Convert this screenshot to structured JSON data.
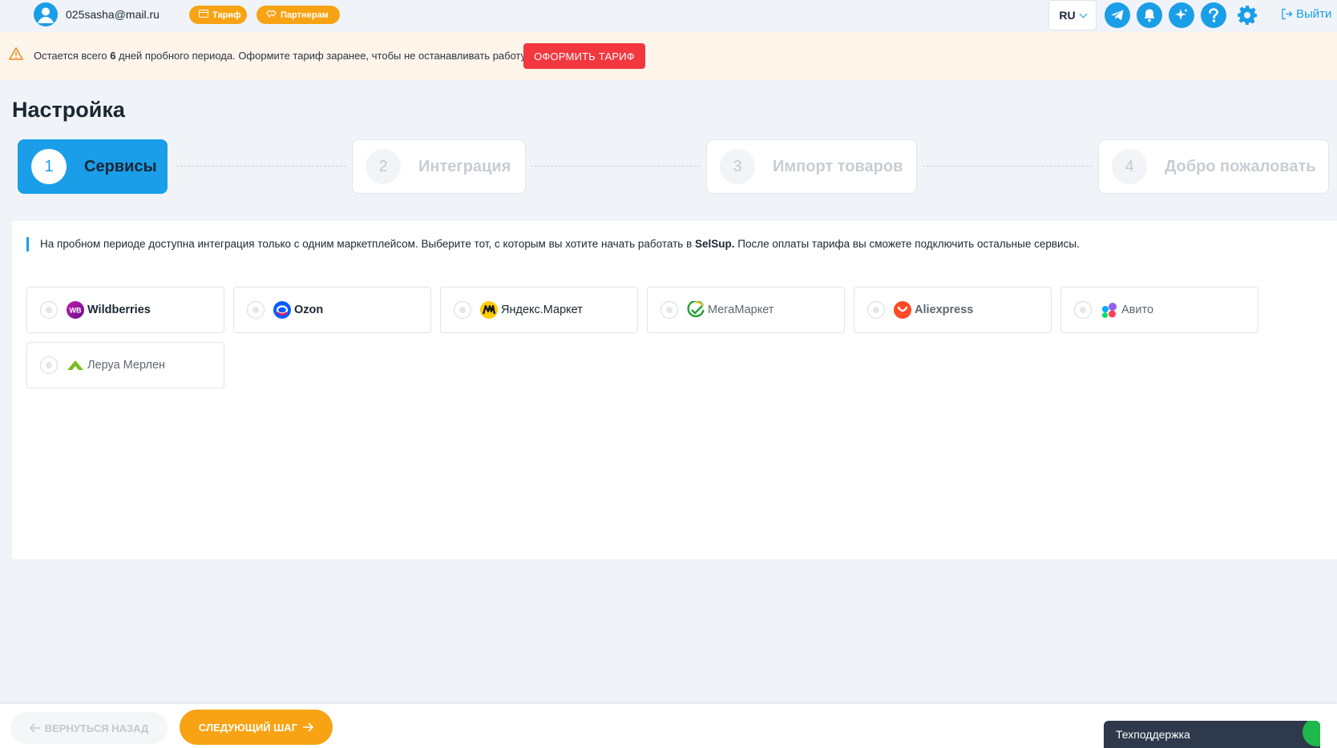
{
  "header": {
    "email": "025sasha@mail.ru",
    "tariff_label": "Тариф",
    "partners_label": "Партнерам",
    "language": "RU",
    "logout_label": "Выйти"
  },
  "warning": {
    "text_before": "Остается всего ",
    "days": "6",
    "text_after": " дней пробного периода. Оформите тариф заранее, чтобы не останавливать работу",
    "button_label": "ОФОРМИТЬ ТАРИФ"
  },
  "page_title": "Настройка",
  "steps": [
    {
      "number": "1",
      "label": "Сервисы",
      "active": true
    },
    {
      "number": "2",
      "label": "Интеграция",
      "active": false
    },
    {
      "number": "3",
      "label": "Импорт товаров",
      "active": false
    },
    {
      "number": "4",
      "label": "Добро пожаловать",
      "active": false
    }
  ],
  "info": {
    "text_before": "На пробном периоде доступна интеграция только с одним маркетплейсом. Выберите тот, с которым вы хотите начать работать в ",
    "brand": "SelSup.",
    "text_after": " После оплаты тарифа вы сможете подключить остальные сервисы."
  },
  "marketplaces": [
    {
      "name": "Wildberries",
      "icon": "wildberries-logo",
      "logo_text": "WB",
      "selected": false
    },
    {
      "name": "Ozon",
      "icon": "ozon-logo",
      "selected": false
    },
    {
      "name": "Яндекс.Маркет",
      "icon": "yandex-market-logo",
      "selected": false
    },
    {
      "name": "МегаМаркет",
      "icon": "megamarket-logo",
      "selected": false
    },
    {
      "name": "Aliexpress",
      "icon": "aliexpress-logo",
      "selected": false
    },
    {
      "name": "Авито",
      "icon": "avito-logo",
      "selected": false
    },
    {
      "name": "Леруа Мерлен",
      "icon": "leroy-merlin-logo",
      "selected": false
    }
  ],
  "footer": {
    "back_label": "ВЕРНУТЬСЯ НАЗАД",
    "next_label": "СЛЕДУЮЩИЙ ШАГ",
    "support_label": "Техподдержка"
  },
  "colors": {
    "accent": "#1a9ee8",
    "orange": "#f7a313",
    "danger": "#f2373f",
    "warning_bg": "#fdf4ea"
  }
}
